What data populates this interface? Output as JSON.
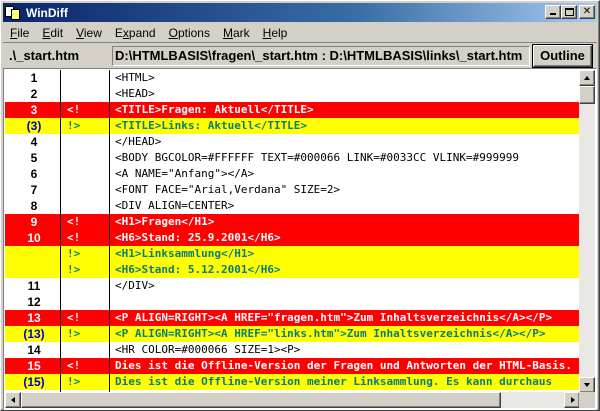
{
  "window": {
    "title": "WinDiff"
  },
  "menu": [
    {
      "pre": "",
      "key": "F",
      "post": "ile"
    },
    {
      "pre": "",
      "key": "E",
      "post": "dit"
    },
    {
      "pre": "",
      "key": "V",
      "post": "iew"
    },
    {
      "pre": "E",
      "key": "x",
      "post": "pand"
    },
    {
      "pre": "",
      "key": "O",
      "post": "ptions"
    },
    {
      "pre": "",
      "key": "M",
      "post": "ark"
    },
    {
      "pre": "",
      "key": "H",
      "post": "elp"
    }
  ],
  "pathbar": {
    "file": ".\\_start.htm",
    "paths": "D:\\HTMLBASIS\\fragen\\_start.htm : D:\\HTMLBASIS\\links\\_start.htm",
    "outline_label": "Outline"
  },
  "colors": {
    "removed": "#ff0000",
    "added": "#ffff00"
  },
  "lines": [
    {
      "num": "1",
      "mark": "",
      "text": "<HTML>",
      "type": "normal"
    },
    {
      "num": "2",
      "mark": "",
      "text": "<HEAD>",
      "type": "normal"
    },
    {
      "num": "3",
      "mark": "<!",
      "text": "<TITLE>Fragen: Aktuell</TITLE>",
      "type": "red"
    },
    {
      "num": "(3)",
      "mark": "!>",
      "text": "<TITLE>Links: Aktuell</TITLE>",
      "type": "yellow"
    },
    {
      "num": "4",
      "mark": "",
      "text": "</HEAD>",
      "type": "normal"
    },
    {
      "num": "5",
      "mark": "",
      "text": "<BODY BGCOLOR=#FFFFFF TEXT=#000066 LINK=#0033CC VLINK=#999999",
      "type": "normal"
    },
    {
      "num": "6",
      "mark": "",
      "text": "<A NAME=\"Anfang\"></A>",
      "type": "normal"
    },
    {
      "num": "7",
      "mark": "",
      "text": "<FONT FACE=\"Arial,Verdana\" SIZE=2>",
      "type": "normal"
    },
    {
      "num": "8",
      "mark": "",
      "text": "<DIV ALIGN=CENTER>",
      "type": "normal"
    },
    {
      "num": "9",
      "mark": "<!",
      "text": "<H1>Fragen</H1>",
      "type": "red"
    },
    {
      "num": "10",
      "mark": "<!",
      "text": "<H6>Stand: 25.9.2001</H6>",
      "type": "red"
    },
    {
      "num": "",
      "mark": "!>",
      "text": "<H1>Linksammlung</H1>",
      "type": "yellow"
    },
    {
      "num": "",
      "mark": "!>",
      "text": "<H6>Stand: 5.12.2001</H6>",
      "type": "yellow"
    },
    {
      "num": "11",
      "mark": "",
      "text": "</DIV>",
      "type": "normal"
    },
    {
      "num": "12",
      "mark": "",
      "text": "",
      "type": "normal"
    },
    {
      "num": "13",
      "mark": "<!",
      "text": "<P ALIGN=RIGHT><A HREF=\"fragen.htm\">Zum Inhaltsverzeichnis</A></P>",
      "type": "red"
    },
    {
      "num": "(13)",
      "mark": "!>",
      "text": "<P ALIGN=RIGHT><A HREF=\"links.htm\">Zum Inhaltsverzeichnis</A></P>",
      "type": "yellow"
    },
    {
      "num": "14",
      "mark": "",
      "text": "<HR COLOR=#000066 SIZE=1><P>",
      "type": "normal"
    },
    {
      "num": "15",
      "mark": "<!",
      "text": "Dies ist die Offline-Version der Fragen und Antworten der HTML-Basis.",
      "type": "red"
    },
    {
      "num": "(15)",
      "mark": "!>",
      "text": "Dies ist die Offline-Version meiner Linksammlung. Es kann durchaus",
      "type": "yellow"
    }
  ]
}
